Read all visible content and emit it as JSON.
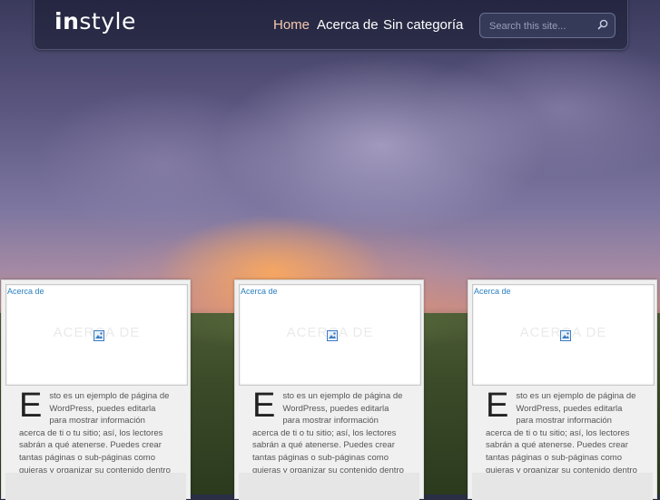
{
  "header": {
    "logo_bold": "in",
    "logo_rest": "style",
    "nav": [
      {
        "label": "Home",
        "active": true
      },
      {
        "label": "Acerca de",
        "active": false
      },
      {
        "label": "Sin categoría",
        "active": false
      }
    ],
    "search": {
      "placeholder": "Search this site...",
      "icon": "search-icon"
    }
  },
  "cards": [
    {
      "thumb_link": "Acerca de",
      "thumb_watermark": "ACERCA DE",
      "thumb_icon": "image-icon",
      "dropcap": "E",
      "excerpt": "sto es un ejemplo de página de WordPress, puedes editarla para mostrar información acerca de ti o tu sitio; así, los lectores sabrán a qué atenerse. Puedes crear tantas páginas o sub-páginas como quieras y organizar su contenido dentro de WordPress."
    },
    {
      "thumb_link": "Acerca de",
      "thumb_watermark": "ACERCA DE",
      "thumb_icon": "image-icon",
      "dropcap": "E",
      "excerpt": "sto es un ejemplo de página de WordPress, puedes editarla para mostrar información acerca de ti o tu sitio; así, los lectores sabrán a qué atenerse. Puedes crear tantas páginas o sub-páginas como quieras y organizar su contenido dentro de WordPress."
    },
    {
      "thumb_link": "Acerca de",
      "thumb_watermark": "ACERCA DE",
      "thumb_icon": "image-icon",
      "dropcap": "E",
      "excerpt": "sto es un ejemplo de página de WordPress, puedes editarla para mostrar información acerca de ti o tu sitio; así, los lectores sabrán a qué atenerse. Puedes crear tantas páginas o sub-páginas como quieras y organizar su contenido dentro de WordPress."
    }
  ],
  "colors": {
    "nav_active": "#f4c9b0",
    "link": "#2a7fc0",
    "card_bg": "#f0f0f0"
  }
}
